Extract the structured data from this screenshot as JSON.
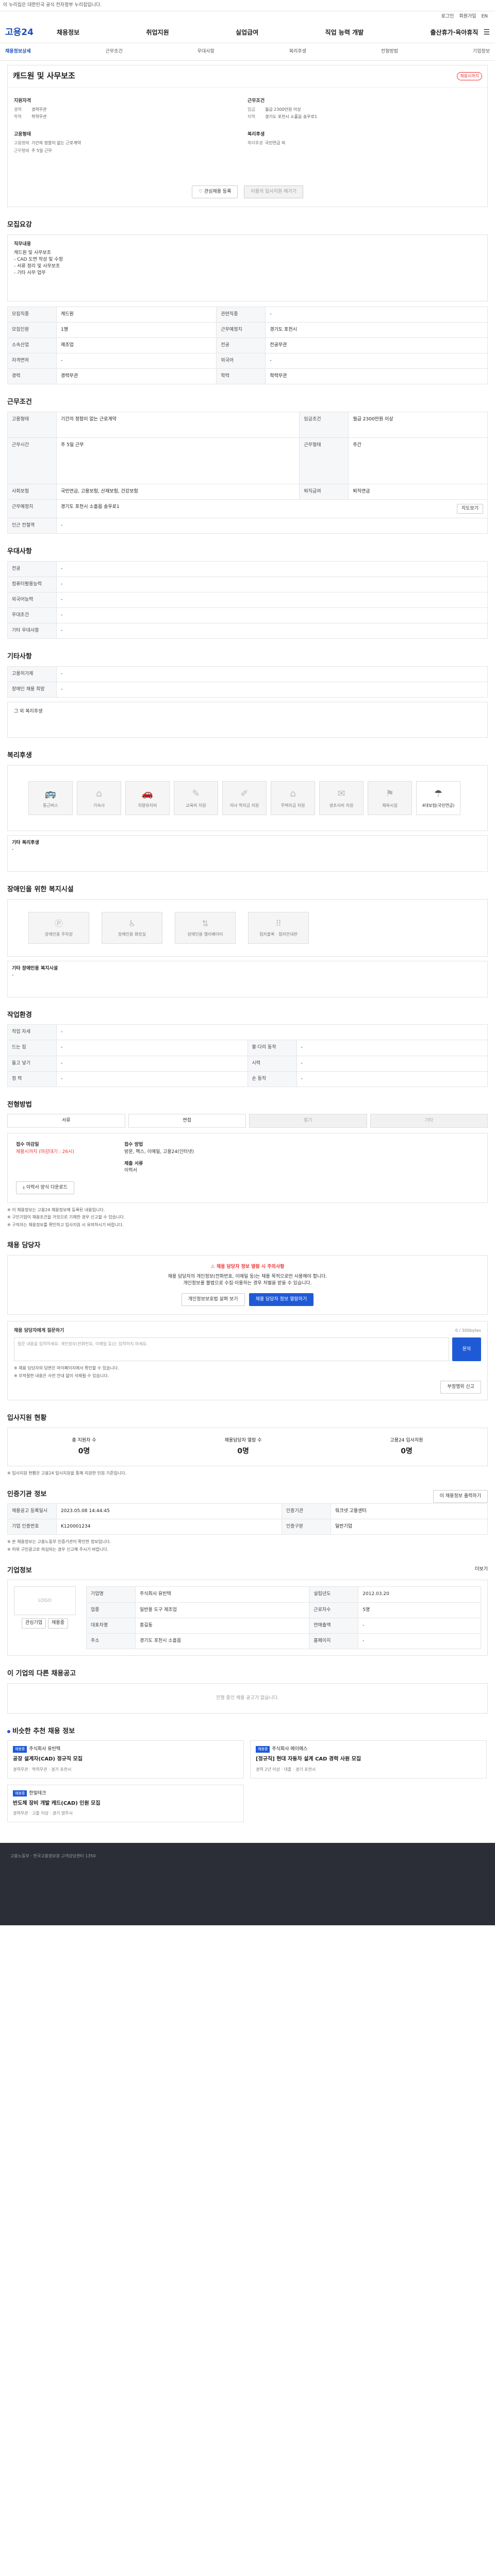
{
  "topbar": {
    "notice": "이 누리집은 대한민국 공식 전자정부 누리집입니다."
  },
  "util": {
    "login": "로그인",
    "join": "회원가입",
    "lang": "EN"
  },
  "gnb": {
    "logo": "고용24",
    "menu": [
      "채용정보",
      "취업지원",
      "실업급여",
      "직업 능력 개발",
      "출산휴가·육아휴직"
    ]
  },
  "subnav": [
    "채용정보상세",
    "근무조건",
    "우대사항",
    "복리후생",
    "전형방법",
    "기업정보"
  ],
  "job": {
    "title": "캐드원 및 사무보조",
    "badge": "채용시까지",
    "qual_title": "지원자격",
    "qual": [
      {
        "k": "경력",
        "v": "경력무관"
      },
      {
        "k": "학력",
        "v": "학력무관"
      }
    ],
    "cond_title": "근무조건",
    "cond": [
      {
        "k": "임금",
        "v": "월급 2300만원 이상"
      },
      {
        "k": "지역",
        "v": "경기도 포천시 소흘읍 송우로1"
      }
    ],
    "emp_title": "고용형태",
    "emp": [
      {
        "k": "고용형태",
        "v": "기간의 정함이 없는 근로계약"
      },
      {
        "k": "근무형태",
        "v": "주 5일 근무"
      }
    ],
    "app_title": "복리후생",
    "app": [
      {
        "k": "복리후생",
        "v": "국민연금 외"
      }
    ],
    "btn_apply": "관심채용 등록",
    "btn_scrap": "이용의 입사지원 해가기"
  },
  "recruit": {
    "title": "모집요강",
    "desc_head": "직무내용",
    "desc_lines": [
      "캐드원 및 사무보조",
      "- CAD 도면 작성 및 수정",
      "- 서류 정리 및 사무보조",
      "- 기타 사무 업무"
    ],
    "rows": [
      [
        "모집직종",
        "캐드원",
        "관련직종",
        "-"
      ],
      [
        "모집인원",
        "1명",
        "근무예정지",
        "경기도 포천시"
      ],
      [
        "소속산업",
        "제조업",
        "전공",
        "전공무관"
      ],
      [
        "자격면허",
        "-",
        "외국어",
        "-"
      ],
      [
        "경력",
        "경력무관",
        "학력",
        "학력무관"
      ]
    ]
  },
  "work": {
    "title": "근무조건",
    "rows": [
      [
        "고용형태",
        "기간의 정함이 없는 근로계약",
        "임금조건",
        "월급 2300만원 이상"
      ],
      [
        "근무시간",
        "주 5일 근무",
        "근무형태",
        "주간"
      ],
      [
        "사회보험",
        "국민연금, 고용보험, 산재보험, 건강보험",
        "퇴직급여",
        "퇴직연금"
      ],
      [
        "근무예정지",
        "경기도 포천시 소흘읍 송우로1",
        "",
        ""
      ],
      [
        "인근 전철역",
        "-",
        "",
        ""
      ]
    ],
    "map_btn": "지도보기"
  },
  "prefer": {
    "title": "우대사항",
    "rows": [
      [
        "전공",
        "-"
      ],
      [
        "컴퓨터활용능력",
        "-"
      ],
      [
        "외국어능력",
        "-"
      ],
      [
        "우대조건",
        "-"
      ],
      [
        "기타 우대사항",
        "-"
      ]
    ]
  },
  "etc": {
    "title": "기타사항",
    "rows": [
      [
        "고용허가제",
        "-"
      ],
      [
        "장애인 채용 희망",
        "-"
      ]
    ],
    "more": "그 외 복리후생"
  },
  "welfare": {
    "title": "복리후생",
    "items": [
      "통근버스",
      "기숙사",
      "차량유지비",
      "교육비 지원",
      "자녀 학자금 지원",
      "주택자금 지원",
      "경조사비 지원",
      "체육시설",
      "4대보험(국민연금)"
    ],
    "etc_label": "기타 복리후생",
    "etc_val": "-"
  },
  "facility": {
    "title": "장애인을 위한 복지시설",
    "items": [
      "장애인용 주차장",
      "장애인용 화장실",
      "장애인용 엘리베이터",
      "점자블록 · 점자안내판"
    ],
    "etc_label": "기타 장애인용 복지시설",
    "etc_val": "-"
  },
  "workenv": {
    "title": "작업환경",
    "rows": [
      [
        "작업 자세",
        "-",
        "",
        ""
      ],
      [
        "드는 힘",
        "-",
        "팔·다리 동작",
        "-"
      ],
      [
        "들고 넣기",
        "-",
        "시력",
        "-"
      ],
      [
        "청 력",
        "-",
        "손 동작",
        "-"
      ]
    ]
  },
  "process": {
    "title": "전형방법",
    "tabs": [
      "서류",
      "면접",
      "필기",
      "기타"
    ],
    "deadline_label": "접수 마감일",
    "deadline": "채용시까지 (마감대기 : 26시)",
    "method_label": "접수 방법",
    "method": "방문, 팩스, 이메일, 고용24(인터넷)",
    "doc_label": "제출 서류",
    "doc": "이력서",
    "doc_btn": "이력서 양식 다운로드",
    "notes": [
      "※ 이 채용정보는 고용24 채용정보에 등록된 내용입니다.",
      "※ 구인기업이 채용조건을 거짓으로 기재한 경우 신고할 수 있습니다.",
      "※ 구직자는 채용정보를 확인하고 입사지원 시 유의하시기 바랍니다."
    ]
  },
  "manager": {
    "title": "채용 담당자",
    "red": "채용 담당자 정보 열람 시 주의사항",
    "line1": "채용 담당자의 개인정보(전화번호, 이메일 등)는 채용 목적으로만 사용해야 합니다.",
    "line2": "개인정보를 불법으로 수집·이용하는 경우 처벌을 받을 수 있습니다.",
    "btn1": "개인정보보호법 살펴 보기",
    "btn2": "채용 담당자 정보 열람하기",
    "q_label": "채용 담당자에게 질문하기",
    "q_counter": "0 / 300bytes",
    "q_placeholder": "질문 내용을 입력하세요. 개인정보(전화번호, 이메일 등)는 입력하지 마세요.",
    "q_btn": "문의",
    "q_notes": [
      "※ 채용 담당자의 답변은 마이페이지에서 확인할 수 있습니다.",
      "※ 부적절한 내용은 사전 안내 없이 삭제될 수 있습니다."
    ],
    "report_btn": "부정행위 신고"
  },
  "stats": {
    "title": "입사지원 현황",
    "items": [
      {
        "label": "총 지원자 수",
        "num": "0명"
      },
      {
        "label": "채용담당자 열람 수",
        "num": "0명"
      },
      {
        "label": "고용24 입사지원",
        "num": "0명"
      }
    ],
    "note": "※ 입사지원 현황은 고용24 입사지원을 통해 지원한 인원 기준입니다."
  },
  "reginfo": {
    "title": "인증기관 정보",
    "btn": "이 채용정보 출력하기",
    "rows": [
      [
        "채용공고 등록일시",
        "2023.05.08 14:44:45",
        "인증기관",
        "워크넷 고용센터"
      ],
      [
        "기업 인증번호",
        "K120001234",
        "인증구분",
        "일반기업"
      ]
    ],
    "notes": [
      "※ 본 채용정보는 고용노동부 인증기관이 확인한 정보입니다.",
      "※ 허위 구인광고로 의심되는 경우 신고해 주시기 바랍니다."
    ]
  },
  "company": {
    "title": "기업정보",
    "more": "더보기",
    "logo": "LOGO",
    "btn1": "관심기업",
    "btn2": "채용중",
    "rows": [
      [
        "기업명",
        "주식회사 유빈텍",
        "설립년도",
        "2012.03.20"
      ],
      [
        "업종",
        "일반용 도구 제조업",
        "근로자수",
        "5명"
      ],
      [
        "대표자명",
        "홍길동",
        "연매출액",
        "-"
      ],
      [
        "주소",
        "경기도 포천시 소흘읍",
        "홈페이지",
        "-"
      ]
    ],
    "map_btn": "지도보기"
  },
  "other": {
    "title": "이 기업의 다른 채용공고",
    "empty": "진행 중인 채용 공고가 없습니다."
  },
  "recommend": {
    "title": "비슷한 추천 채용 정보",
    "items": [
      {
        "tag": "채용중",
        "company": "주식회사 유빈텍",
        "title": "공장 설계자(CAD) 정규직 모집",
        "meta": "경력무관 · 학력무관 · 경기 포천시"
      },
      {
        "tag": "채용중",
        "company": "주식회사 에이에스",
        "title": "[정규직] 현대 자동차 설계 CAD 경력 사원 모집",
        "meta": "경력 2년 이상 · 대졸 · 경기 포천시"
      },
      {
        "tag": "채용중",
        "company": "한빛테크",
        "title": "반도체 장비 개발 캐드(CAD) 인원 모집",
        "meta": "경력무관 · 고졸 이상 · 경기 양주시"
      }
    ]
  },
  "footer": {
    "text": "고용노동부 · 한국고용정보원 고객상담센터 1350"
  }
}
